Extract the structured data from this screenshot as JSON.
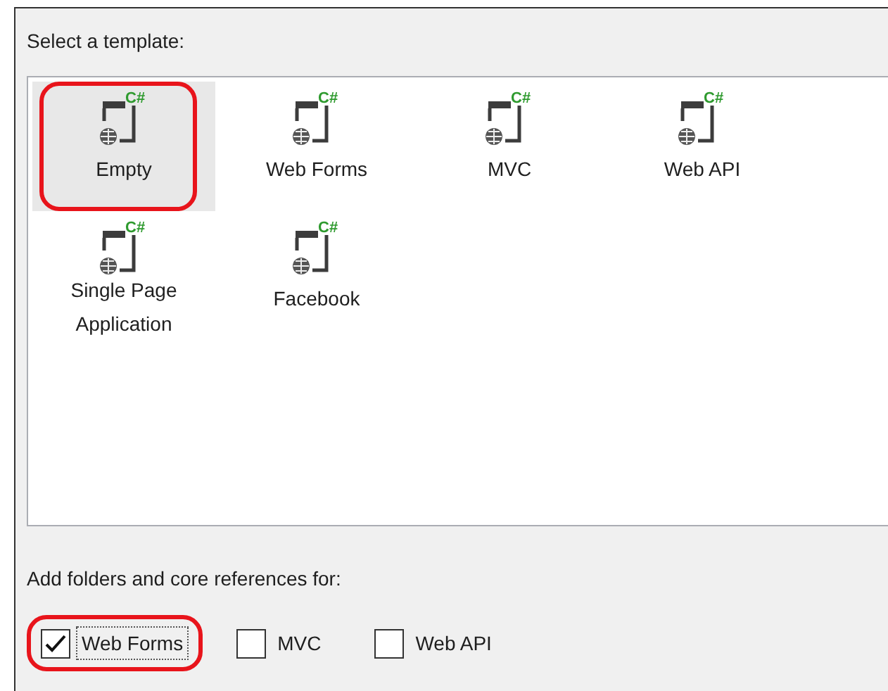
{
  "template_section": {
    "label": "Select a template:"
  },
  "templates": [
    {
      "label": "Empty",
      "badge": "C#",
      "selected": true,
      "highlighted": true
    },
    {
      "label": "Web Forms",
      "badge": "C#",
      "selected": false,
      "highlighted": false
    },
    {
      "label": "MVC",
      "badge": "C#",
      "selected": false,
      "highlighted": false
    },
    {
      "label": "Web API",
      "badge": "C#",
      "selected": false,
      "highlighted": false
    },
    {
      "label": "Single Page Application",
      "badge": "C#",
      "selected": false,
      "highlighted": false
    },
    {
      "label": "Facebook",
      "badge": "C#",
      "selected": false,
      "highlighted": false
    }
  ],
  "references": {
    "label": "Add folders and core references for:",
    "options": [
      {
        "label": "Web Forms",
        "checked": true,
        "focused": true,
        "highlighted": true
      },
      {
        "label": "MVC",
        "checked": false,
        "focused": false,
        "highlighted": false
      },
      {
        "label": "Web API",
        "checked": false,
        "focused": false,
        "highlighted": false
      }
    ]
  }
}
